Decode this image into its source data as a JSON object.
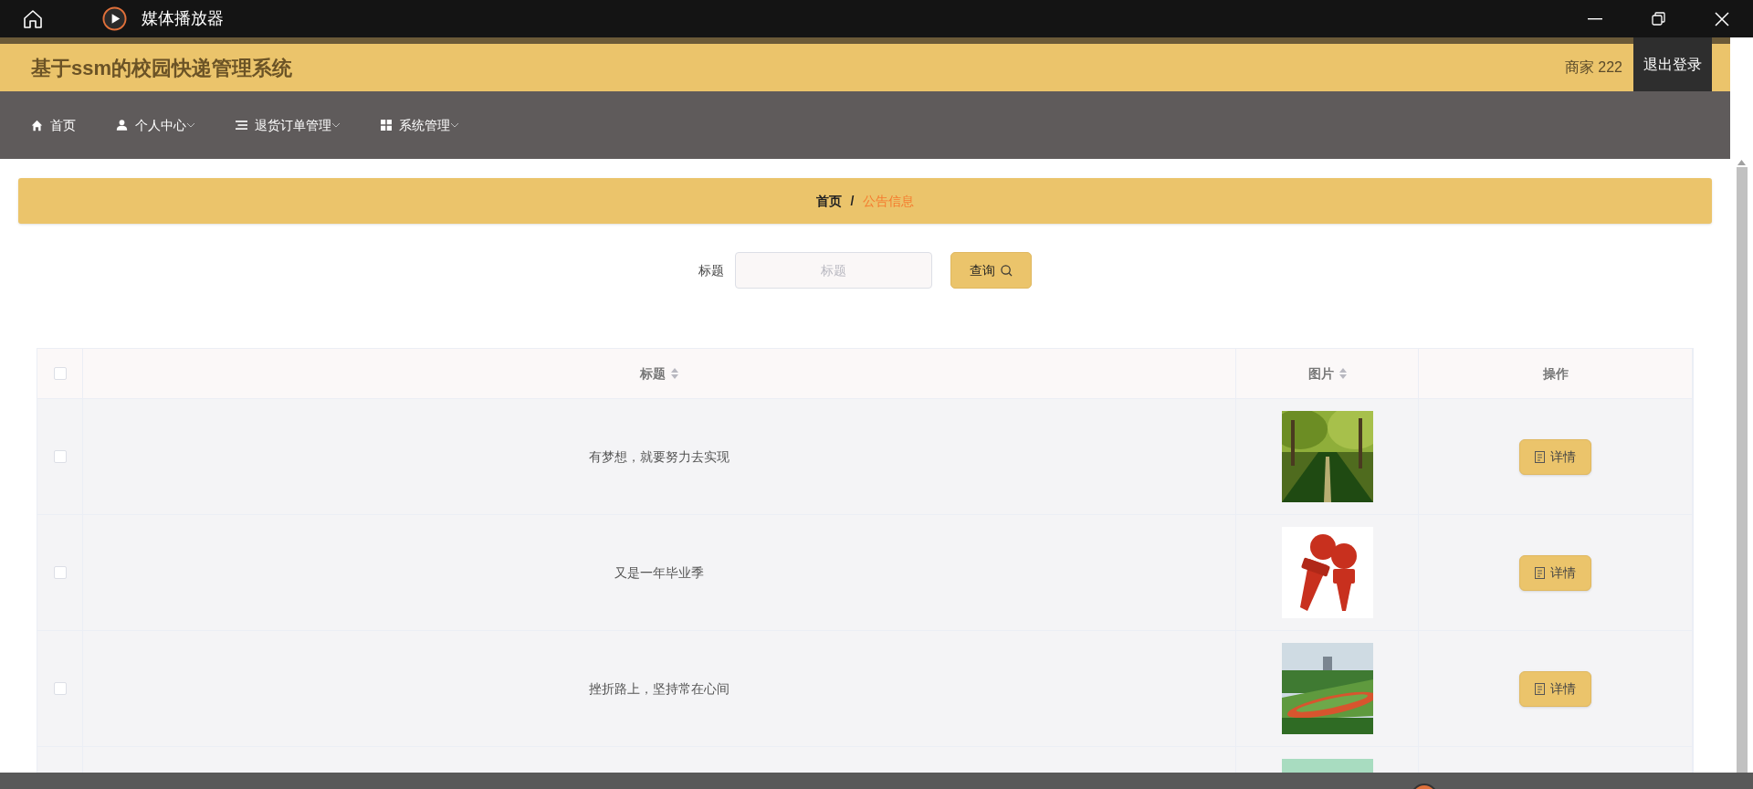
{
  "window": {
    "title": "媒体播放器"
  },
  "header": {
    "title": "基于ssm的校园快递管理系统",
    "user": "商家 222",
    "logout": "退出登录"
  },
  "nav": [
    {
      "label": "首页",
      "kind": "home",
      "dropdown": false
    },
    {
      "label": "个人中心",
      "kind": "user",
      "dropdown": true
    },
    {
      "label": "退货订单管理",
      "kind": "list",
      "dropdown": true
    },
    {
      "label": "系统管理",
      "kind": "grid",
      "dropdown": true
    }
  ],
  "breadcrumb": {
    "separator": "/",
    "items": [
      {
        "label": "首页",
        "current": false
      },
      {
        "label": "公告信息",
        "current": true
      }
    ]
  },
  "search": {
    "label": "标题",
    "placeholder": "标题",
    "button": "查询"
  },
  "table": {
    "select_all_checked": false,
    "columns": [
      {
        "label": "标题",
        "sortable": true
      },
      {
        "label": "图片",
        "sortable": true
      },
      {
        "label": "操作",
        "sortable": false
      }
    ],
    "rows": [
      {
        "title": "有梦想，就要努力去实现",
        "checked": false,
        "image": {
          "kind": "picture"
        },
        "action": "详情"
      },
      {
        "title": "又是一年毕业季",
        "checked": false,
        "image": {
          "kind": "picture"
        },
        "action": "详情"
      },
      {
        "title": "挫折路上，坚持常在心间",
        "checked": false,
        "image": {
          "kind": "picture"
        },
        "action": "详情"
      },
      {
        "image": {
          "kind": "picture"
        }
      }
    ]
  }
}
